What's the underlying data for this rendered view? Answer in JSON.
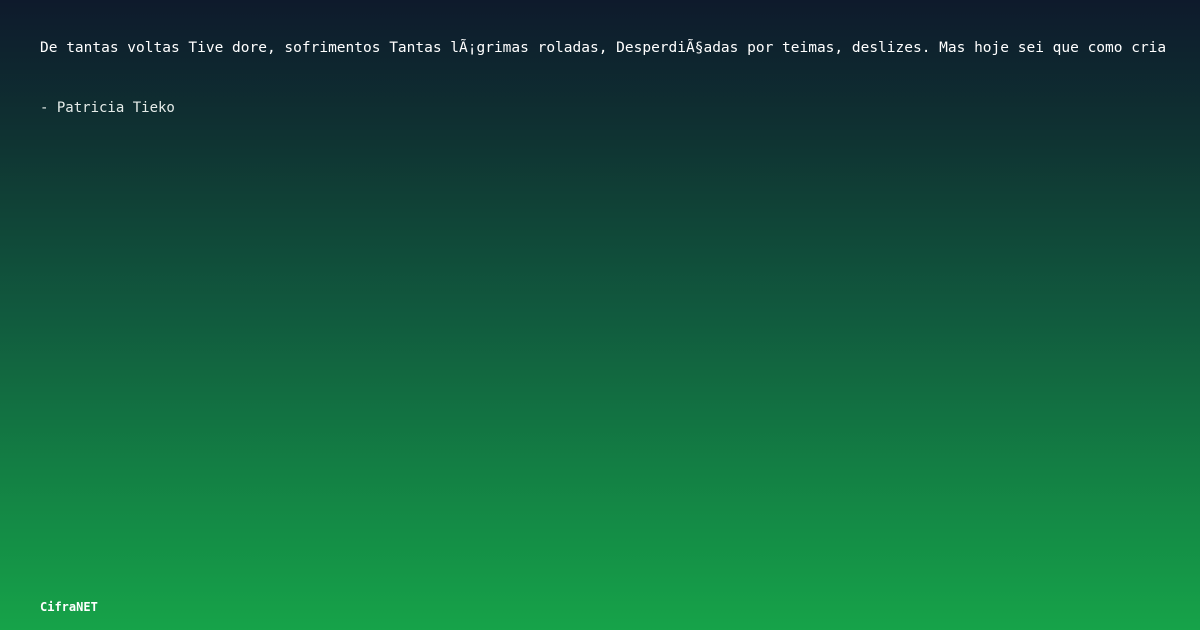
{
  "card": {
    "quote": "De tantas voltas Tive dore, sofrimentos Tantas lÃ¡grimas roladas, DesperdiÃ§adas por teimas, deslizes. Mas hoje sei que como cria",
    "author": "- Patricia Tieko",
    "brand": "CifraNET"
  },
  "colors": {
    "background_top": "#0e1a2c",
    "background_bottom": "#16a349",
    "text": "#ffffff"
  }
}
